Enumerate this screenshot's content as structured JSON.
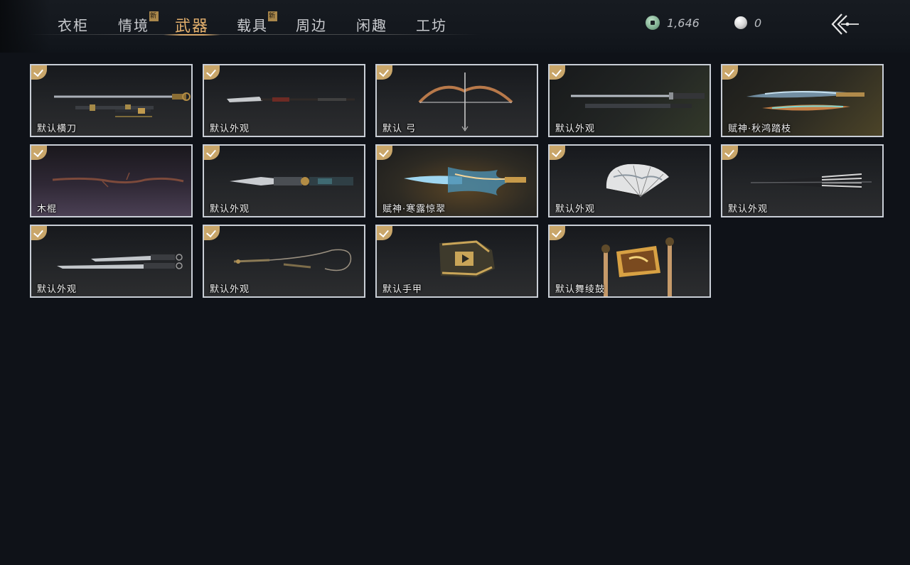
{
  "header": {
    "tabs": [
      {
        "label": "衣柜",
        "active": false,
        "new": false
      },
      {
        "label": "情境",
        "active": false,
        "new": true
      },
      {
        "label": "武器",
        "active": true,
        "new": false
      },
      {
        "label": "载具",
        "active": false,
        "new": true
      },
      {
        "label": "周边",
        "active": false,
        "new": false
      },
      {
        "label": "闲趣",
        "active": false,
        "new": false
      },
      {
        "label": "工坊",
        "active": false,
        "new": false
      }
    ],
    "new_badge": "新",
    "currency_jade": {
      "icon": "jade-coin-icon",
      "value": "1,646"
    },
    "currency_pearl": {
      "icon": "pearl-icon",
      "value": "0"
    },
    "back_icon": "back-arrow-icon"
  },
  "items": [
    {
      "label": "默认横刀",
      "owned": true,
      "icon": "saber-icon"
    },
    {
      "label": "默认外观",
      "owned": true,
      "icon": "spear-icon"
    },
    {
      "label": "默认 弓",
      "owned": true,
      "icon": "bow-icon"
    },
    {
      "label": "默认外观",
      "owned": true,
      "icon": "sword-icon"
    },
    {
      "label": "赋神·秋鸿踏枝",
      "owned": true,
      "icon": "ornate-sword-icon"
    },
    {
      "label": "木棍",
      "owned": true,
      "icon": "staff-icon"
    },
    {
      "label": "默认外观",
      "owned": true,
      "icon": "blade-icon"
    },
    {
      "label": "赋神·寒露惊翠",
      "owned": true,
      "icon": "glowing-blade-icon"
    },
    {
      "label": "默认外观",
      "owned": true,
      "icon": "fan-icon"
    },
    {
      "label": "默认外观",
      "owned": true,
      "icon": "umbrella-icon"
    },
    {
      "label": "默认外观",
      "owned": true,
      "icon": "twin-blades-icon"
    },
    {
      "label": "默认外观",
      "owned": true,
      "icon": "rope-dart-icon"
    },
    {
      "label": "默认手甲",
      "owned": true,
      "icon": "gauntlet-icon"
    },
    {
      "label": "默认舞绫鼓",
      "owned": true,
      "icon": "drum-icon"
    }
  ],
  "colors": {
    "background": "#0f1218",
    "active_tab": "#e3b06d",
    "check_badge": "#c9a66a",
    "card_border": "#c9ced6"
  }
}
